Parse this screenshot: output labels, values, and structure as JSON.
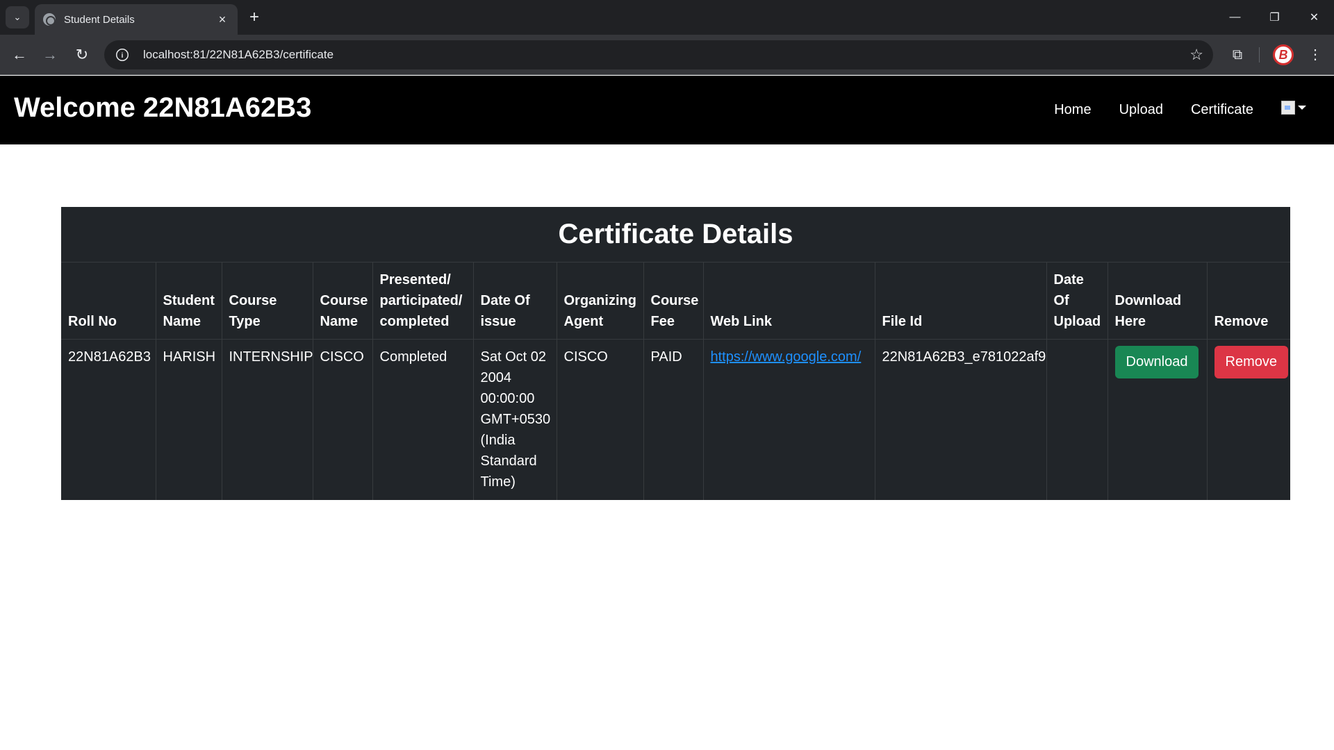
{
  "browser": {
    "tab_title": "Student Details",
    "url": "localhost:81/22N81A62B3/certificate"
  },
  "navbar": {
    "brand": "Welcome 22N81A62B3",
    "links": [
      "Home",
      "Upload",
      "Certificate"
    ]
  },
  "card": {
    "title": "Certificate Details",
    "headers": [
      "Roll No",
      "Student Name",
      "Course Type",
      "Course Name",
      "Presented/ participated/ completed",
      "Date Of issue",
      "Organizing Agent",
      "Course Fee",
      "Web Link",
      "File Id",
      "Date Of Upload",
      "Download Here",
      "Remove"
    ],
    "rows": [
      {
        "roll_no": "22N81A62B3",
        "student_name": "HARISH",
        "course_type": "INTERNSHIP",
        "course_name": "CISCO",
        "status": "Completed",
        "date_of_issue": "Sat Oct 02 2004 00:00:00 GMT+0530 (India Standard Time)",
        "organizing_agent": "CISCO",
        "course_fee": "PAID",
        "web_link": "https://www.google.com/",
        "file_id": "22N81A62B3_e781022af9",
        "date_of_upload": "",
        "download_label": "Download",
        "remove_label": "Remove"
      }
    ]
  },
  "colors": {
    "download_button": "#198754",
    "remove_button": "#dc3545",
    "table_bg": "#212529",
    "navbar_bg": "#000000"
  }
}
